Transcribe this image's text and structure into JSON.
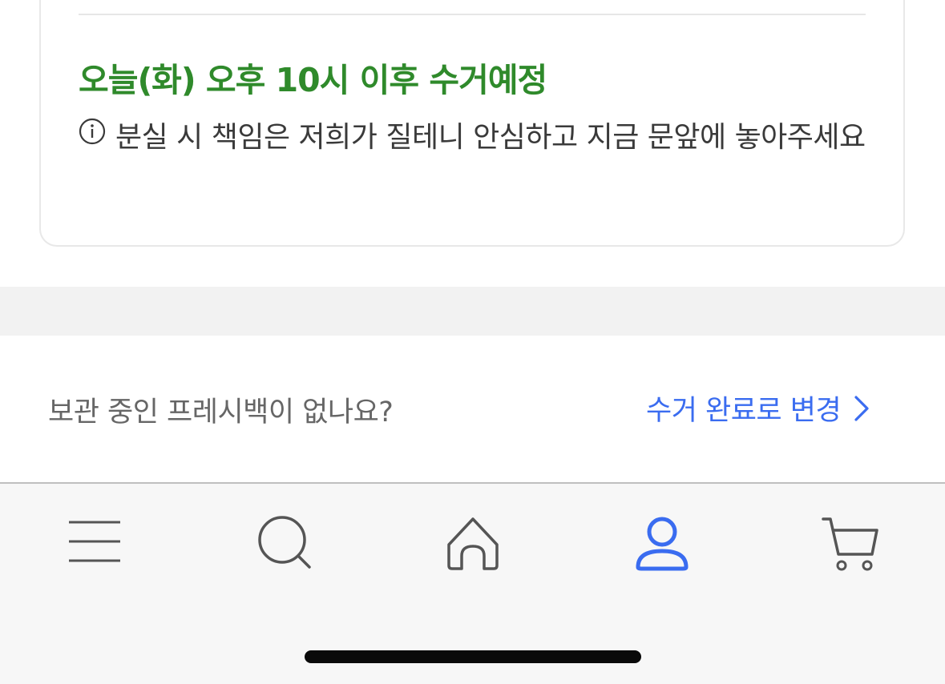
{
  "pickup_card": {
    "schedule_title": "오늘(화) 오후 10시 이후 수거예정",
    "notice_text": "분실 시 책임은 저희가 질테니 안심하고 지금 문앞에 놓아주세요",
    "notice_icon": "info-circle-icon",
    "title_color": "#2f8a2b"
  },
  "fresh_bag_row": {
    "question": "보관 중인 프레시백이 없나요?",
    "action_label": "수거 완료로 변경",
    "action_icon": "chevron-right-icon",
    "action_color": "#3a6cf0"
  },
  "tab_bar": {
    "active_tab": "my-page",
    "active_color": "#3a6cf0",
    "tabs": [
      {
        "id": "menu",
        "icon": "hamburger-menu-icon"
      },
      {
        "id": "search",
        "icon": "search-icon"
      },
      {
        "id": "home",
        "icon": "home-icon"
      },
      {
        "id": "my-page",
        "icon": "person-icon"
      },
      {
        "id": "cart",
        "icon": "cart-icon"
      }
    ]
  }
}
